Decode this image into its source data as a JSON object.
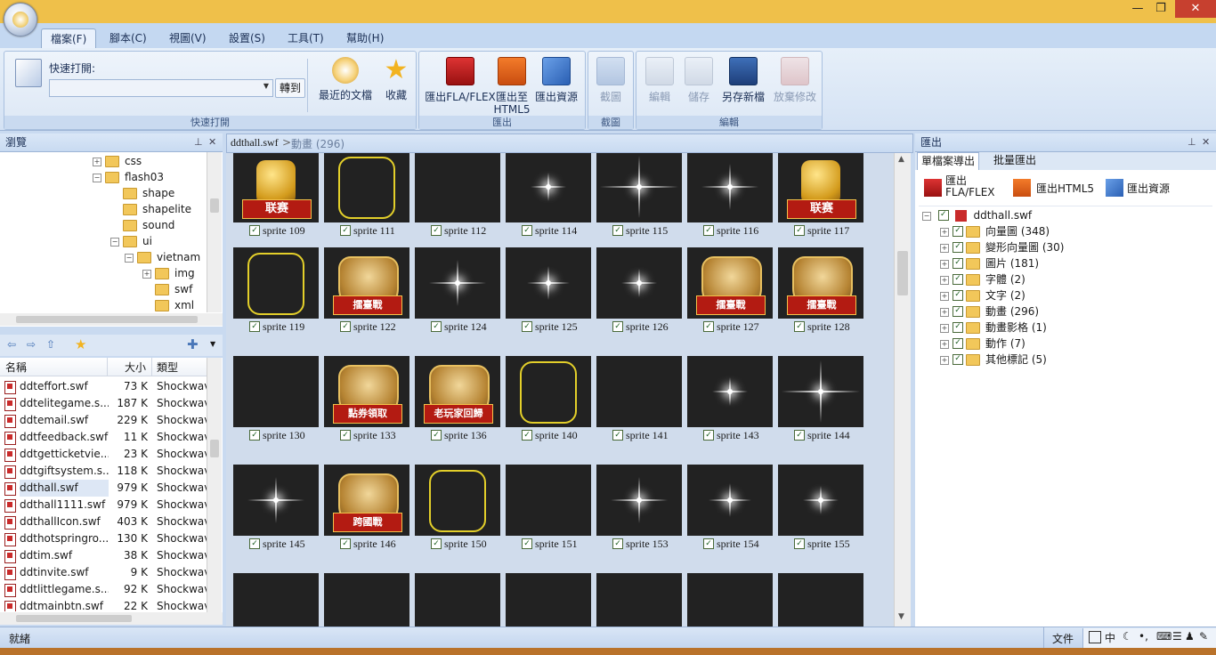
{
  "window": {
    "minimize": "—",
    "maximize": "❐",
    "close": "✕"
  },
  "tabs": [
    "檔案(F)",
    "腳本(C)",
    "視圖(V)",
    "設置(S)",
    "工具(T)",
    "幫助(H)"
  ],
  "ribbon": {
    "quick_open_label": "快速打開:",
    "quick_open_value": "",
    "go_button": "轉到",
    "recent_docs": "最近的文檔",
    "favorites": "收藏",
    "group_quick_open": "快速打開",
    "export_fla": "匯出FLA/FLEX",
    "export_html5_line1": "匯出至",
    "export_html5_line2": "HTML5",
    "export_resources": "匯出資源",
    "group_export": "匯出",
    "screenshot": "截圖",
    "group_screenshot": "截圖",
    "edit": "編輯",
    "save": "儲存",
    "save_as": "另存新檔",
    "discard": "放棄修改",
    "group_edit": "編輯"
  },
  "browse_panel": {
    "title": "瀏覽",
    "tree": [
      {
        "label": "css",
        "level": 0
      },
      {
        "label": "flash03",
        "level": 0
      },
      {
        "label": "shape",
        "level": 1
      },
      {
        "label": "shapelite",
        "level": 1
      },
      {
        "label": "sound",
        "level": 1
      },
      {
        "label": "ui",
        "level": 1
      },
      {
        "label": "vietnam",
        "level": 2
      },
      {
        "label": "img",
        "level": 3
      },
      {
        "label": "swf",
        "level": 3
      },
      {
        "label": "xml",
        "level": 3
      }
    ]
  },
  "file_list": {
    "columns": {
      "name": "名稱",
      "size": "大小",
      "type": "類型"
    },
    "rows": [
      {
        "name": "ddteffort.swf",
        "size": "73 K",
        "type": "Shockwav"
      },
      {
        "name": "ddtelitegame.s...",
        "size": "187 K",
        "type": "Shockwav"
      },
      {
        "name": "ddtemail.swf",
        "size": "229 K",
        "type": "Shockwav"
      },
      {
        "name": "ddtfeedback.swf",
        "size": "11 K",
        "type": "Shockwav"
      },
      {
        "name": "ddtgetticketvie...",
        "size": "23 K",
        "type": "Shockwav"
      },
      {
        "name": "ddtgiftsystem.s...",
        "size": "118 K",
        "type": "Shockwav"
      },
      {
        "name": "ddthall.swf",
        "size": "979 K",
        "type": "Shockwav"
      },
      {
        "name": "ddthall1111.swf",
        "size": "979 K",
        "type": "Shockwav"
      },
      {
        "name": "ddthallIcon.swf",
        "size": "403 K",
        "type": "Shockwav"
      },
      {
        "name": "ddthotspringro...",
        "size": "130 K",
        "type": "Shockwav"
      },
      {
        "name": "ddtim.swf",
        "size": "38 K",
        "type": "Shockwav"
      },
      {
        "name": "ddtinvite.swf",
        "size": "9 K",
        "type": "Shockwav"
      },
      {
        "name": "ddtlittlegame.s...",
        "size": "92 K",
        "type": "Shockwav"
      },
      {
        "name": "ddtmainbtn.swf",
        "size": "22 K",
        "type": "Shockwav"
      }
    ]
  },
  "breadcrumb": {
    "file": "ddthall.swf",
    "separator": ">",
    "section": "動畫 (296)"
  },
  "sprites": [
    {
      "label": "sprite 109",
      "kind": "trophy",
      "text": "联赛"
    },
    {
      "label": "sprite 111",
      "kind": "outline"
    },
    {
      "label": "sprite 112",
      "kind": "empty"
    },
    {
      "label": "sprite 114",
      "kind": "sparkle"
    },
    {
      "label": "sprite 115",
      "kind": "sparkle"
    },
    {
      "label": "sprite 116",
      "kind": "sparkle"
    },
    {
      "label": "sprite 117",
      "kind": "trophy",
      "text": "联赛"
    },
    {
      "label": "sprite 119",
      "kind": "outline"
    },
    {
      "label": "sprite 122",
      "kind": "badge",
      "text": "擂臺戰"
    },
    {
      "label": "sprite 124",
      "kind": "sparkle"
    },
    {
      "label": "sprite 125",
      "kind": "sparkle"
    },
    {
      "label": "sprite 126",
      "kind": "sparkle"
    },
    {
      "label": "sprite 127",
      "kind": "badge",
      "text": "擂臺戰"
    },
    {
      "label": "sprite 128",
      "kind": "badge",
      "text": "擂臺戰"
    },
    {
      "label": "sprite 130",
      "kind": "empty"
    },
    {
      "label": "sprite 133",
      "kind": "badge",
      "text": "點券領取"
    },
    {
      "label": "sprite 136",
      "kind": "badge",
      "text": "老玩家回歸"
    },
    {
      "label": "sprite 140",
      "kind": "outline"
    },
    {
      "label": "sprite 141",
      "kind": "empty"
    },
    {
      "label": "sprite 143",
      "kind": "sparkle"
    },
    {
      "label": "sprite 144",
      "kind": "sparkle"
    },
    {
      "label": "sprite 145",
      "kind": "sparkle"
    },
    {
      "label": "sprite 146",
      "kind": "badge",
      "text": "跨國戰"
    },
    {
      "label": "sprite 150",
      "kind": "outline"
    },
    {
      "label": "sprite 151",
      "kind": "empty"
    },
    {
      "label": "sprite 153",
      "kind": "sparkle"
    },
    {
      "label": "sprite 154",
      "kind": "sparkle"
    },
    {
      "label": "sprite 155",
      "kind": "sparkle"
    }
  ],
  "export_panel": {
    "title": "匯出",
    "tab_single": "單檔案導出",
    "tab_batch": "批量匯出",
    "btn_fla_line1": "匯出",
    "btn_fla_line2": "FLA/FLEX",
    "btn_html5": "匯出HTML5",
    "btn_resources": "匯出資源",
    "root": "ddthall.swf",
    "items": [
      "向量圖 (348)",
      "變形向量圖 (30)",
      "圖片 (181)",
      "字體 (2)",
      "文字 (2)",
      "動畫 (296)",
      "動畫影格 (1)",
      "動作 (7)",
      "其他標記 (5)"
    ]
  },
  "status": {
    "text": "就緒",
    "right_label": "文件",
    "ime": "中"
  }
}
